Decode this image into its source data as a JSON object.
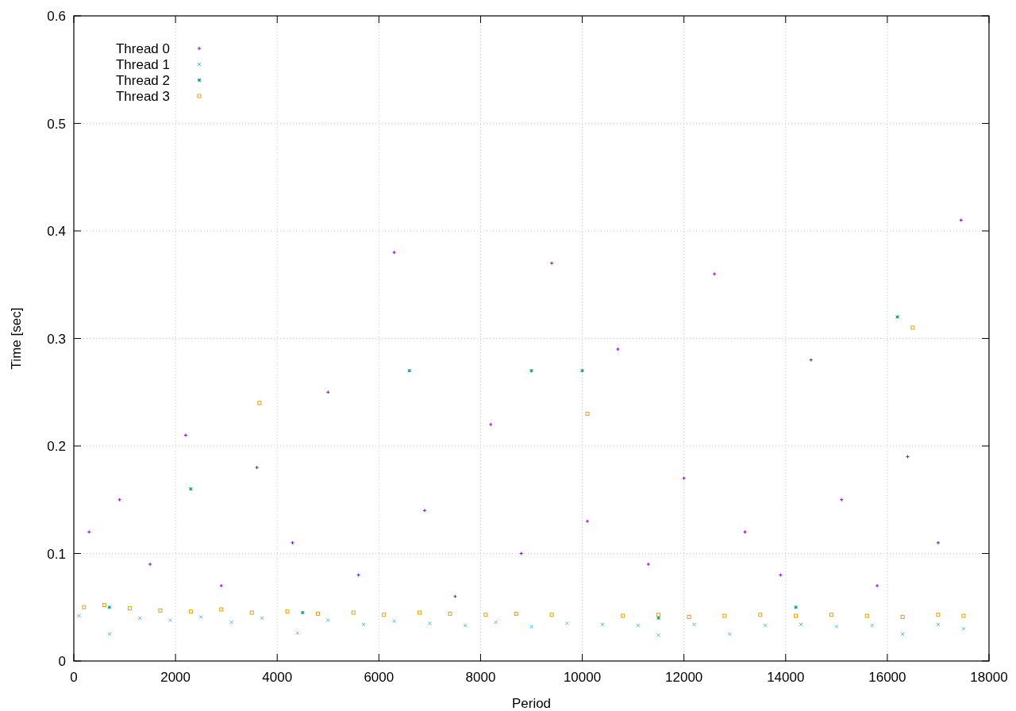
{
  "chart_data": {
    "type": "scatter",
    "xlabel": "Period",
    "ylabel": "Time [sec]",
    "xlim": [
      0,
      18000
    ],
    "ylim": [
      0,
      0.6
    ],
    "xticks": [
      0,
      2000,
      4000,
      6000,
      8000,
      10000,
      12000,
      14000,
      16000,
      18000
    ],
    "yticks": [
      0,
      0.1,
      0.2,
      0.3,
      0.4,
      0.5,
      0.6
    ],
    "grid": true,
    "legend": true,
    "series": [
      {
        "name": "Thread 0",
        "color": "#9400d3",
        "x": [
          300,
          900,
          1500,
          2200,
          2900,
          3600,
          4300,
          5000,
          5600,
          6300,
          6900,
          7500,
          8200,
          8800,
          9400,
          10100,
          10700,
          11300,
          12000,
          12600,
          13200,
          13900,
          14500,
          15100,
          15800,
          16400,
          17000,
          17450
        ],
        "values": [
          0.12,
          0.15,
          0.09,
          0.21,
          0.07,
          0.18,
          0.11,
          0.25,
          0.08,
          0.38,
          0.14,
          0.06,
          0.22,
          0.1,
          0.37,
          0.13,
          0.29,
          0.09,
          0.17,
          0.36,
          0.12,
          0.08,
          0.28,
          0.15,
          0.07,
          0.19,
          0.11,
          0.41
        ]
      },
      {
        "name": "Thread 1",
        "color": "#56b4e9",
        "x": [
          100,
          700,
          1300,
          1900,
          2500,
          3100,
          3700,
          4400,
          5000,
          5700,
          6300,
          7000,
          7700,
          8300,
          9000,
          9700,
          10400,
          11100,
          11500,
          12200,
          12900,
          13600,
          14300,
          15000,
          15700,
          16300,
          17000,
          17500
        ],
        "values": [
          0.042,
          0.025,
          0.04,
          0.038,
          0.041,
          0.036,
          0.04,
          0.026,
          0.038,
          0.034,
          0.037,
          0.035,
          0.033,
          0.036,
          0.032,
          0.035,
          0.034,
          0.033,
          0.024,
          0.034,
          0.025,
          0.033,
          0.034,
          0.032,
          0.033,
          0.025,
          0.034,
          0.03
        ]
      },
      {
        "name": "Thread 2",
        "color": "#009e73",
        "x": [
          700,
          2300,
          4500,
          6600,
          9000,
          10000,
          11500,
          14200,
          16200
        ],
        "values": [
          0.05,
          0.16,
          0.045,
          0.27,
          0.27,
          0.27,
          0.04,
          0.05,
          0.32
        ]
      },
      {
        "name": "Thread 3",
        "color": "#e69f00",
        "x": [
          200,
          600,
          1100,
          1700,
          2300,
          2900,
          3500,
          3650,
          4200,
          4800,
          5500,
          6100,
          6800,
          7400,
          8100,
          8700,
          9400,
          10100,
          10800,
          11500,
          12100,
          12800,
          13500,
          14200,
          14900,
          15600,
          16300,
          16500,
          17000,
          17500
        ],
        "values": [
          0.05,
          0.052,
          0.049,
          0.047,
          0.046,
          0.048,
          0.045,
          0.24,
          0.046,
          0.044,
          0.045,
          0.043,
          0.045,
          0.044,
          0.043,
          0.044,
          0.043,
          0.23,
          0.042,
          0.043,
          0.041,
          0.042,
          0.043,
          0.042,
          0.043,
          0.042,
          0.041,
          0.31,
          0.043,
          0.042
        ]
      }
    ]
  }
}
